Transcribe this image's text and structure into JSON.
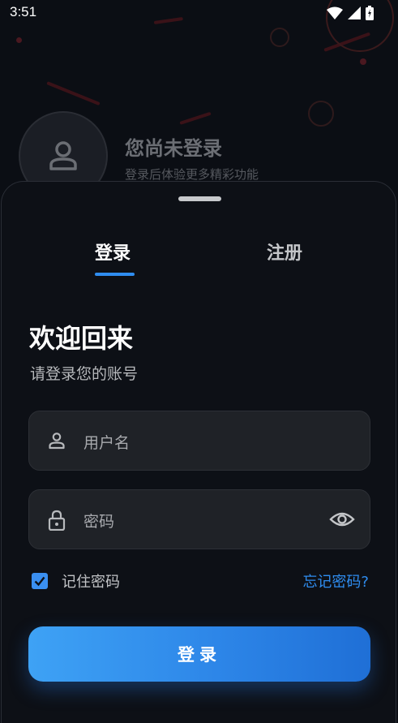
{
  "status_bar": {
    "time": "3:51"
  },
  "header": {
    "title": "您尚未登录",
    "subtitle": "登录后体验更多精彩功能"
  },
  "tabs": [
    {
      "label": "登录",
      "active": true
    },
    {
      "label": "注册",
      "active": false
    }
  ],
  "form": {
    "title": "欢迎回来",
    "subtitle": "请登录您的账号",
    "username_placeholder": "用户名",
    "password_placeholder": "密码",
    "remember_label": "记住密码",
    "remember_checked": true,
    "forgot_label": "忘记密码?",
    "submit_label": "登录"
  },
  "colors": {
    "accent": "#2f8df0",
    "background": "#0d1016",
    "field_background": "#1f2227"
  },
  "icons": [
    "wifi-icon",
    "signal-icon",
    "battery-icon",
    "user-icon",
    "lock-icon",
    "eye-icon",
    "check-icon"
  ]
}
